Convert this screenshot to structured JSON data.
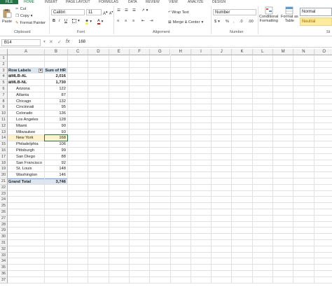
{
  "menu": {
    "file": "FILE",
    "tabs": [
      "HOME",
      "INSERT",
      "PAGE LAYOUT",
      "FORMULAS",
      "DATA",
      "REVIEW",
      "VIEW",
      "ANALYZE",
      "DESIGN"
    ]
  },
  "clipboard": {
    "paste": "Paste",
    "cut": "Cut",
    "copy": "Copy",
    "format_painter": "Format Painter",
    "label": "Clipboard"
  },
  "font": {
    "name": "Calibri",
    "size": "11",
    "label": "Font",
    "bold": "B",
    "italic": "I",
    "underline": "U"
  },
  "alignment": {
    "wrap_text": "Wrap Text",
    "merge_center": "Merge & Center",
    "label": "Alignment"
  },
  "number": {
    "format": "Number",
    "label": "Number",
    "currency": "$",
    "percent": "%",
    "comma": ",",
    "dec_inc": ".0",
    "dec_dec": ".00"
  },
  "styles": {
    "conditional": "Conditional",
    "conditional2": "Formatting",
    "format_as": "Format as",
    "format_as2": "Table",
    "normal": "Normal",
    "neutral": "Neutral",
    "label": "St"
  },
  "formula_bar": {
    "name_box": "B14",
    "value": "168",
    "fx": "fx"
  },
  "columns": [
    "A",
    "B",
    "C",
    "D",
    "E",
    "F",
    "G",
    "H",
    "I",
    "J",
    "K",
    "L",
    "M",
    "N",
    "O"
  ],
  "rows": [
    "1",
    "2",
    "3",
    "4",
    "5",
    "6",
    "7",
    "8",
    "9",
    "10",
    "11",
    "12",
    "13",
    "14",
    "15",
    "16",
    "17",
    "18",
    "19",
    "20",
    "21",
    "22",
    "23",
    "24",
    "25",
    "26",
    "27",
    "28",
    "29",
    "30",
    "31",
    "32",
    "33",
    "34",
    "35",
    "36",
    "37"
  ],
  "pivot": {
    "header_label": "Row Labels",
    "header_value": "Sum of HR",
    "groups": [
      {
        "label": "MLB-AL",
        "value": "2,016"
      },
      {
        "label": "MLB-NL",
        "value": "1,730"
      }
    ],
    "items": [
      {
        "label": "Arizona",
        "value": "122"
      },
      {
        "label": "Atlanta",
        "value": "87"
      },
      {
        "label": "Chicago",
        "value": "132"
      },
      {
        "label": "Cincinnati",
        "value": "95"
      },
      {
        "label": "Colorado",
        "value": "136"
      },
      {
        "label": "Los Angeles",
        "value": "128"
      },
      {
        "label": "Miami",
        "value": "90"
      },
      {
        "label": "Milwaukee",
        "value": "93"
      },
      {
        "label": "New York",
        "value": "168"
      },
      {
        "label": "Philadelphia",
        "value": "106"
      },
      {
        "label": "Pittsburgh",
        "value": "99"
      },
      {
        "label": "San Diego",
        "value": "88"
      },
      {
        "label": "San Francisco",
        "value": "92"
      },
      {
        "label": "St. Louis",
        "value": "148"
      },
      {
        "label": "Washington",
        "value": "146"
      }
    ],
    "grand_total_label": "Grand Total",
    "grand_total_value": "3,746"
  },
  "colors": {
    "accent": "#217346",
    "pivot_header": "#dce6f1",
    "selected_row": "#fff2cc",
    "neutral": "#ffeb9c"
  }
}
